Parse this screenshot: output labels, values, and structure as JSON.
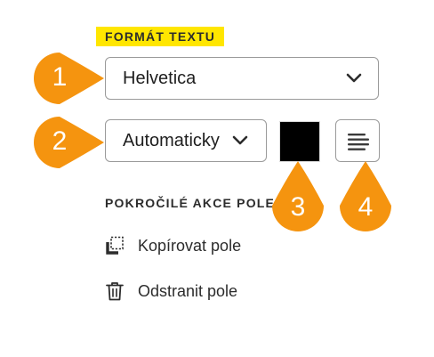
{
  "text_format": {
    "title": "FORMÁT TEXTU",
    "font_select": {
      "value": "Helvetica",
      "icon": "chevron-down-icon"
    },
    "size_select": {
      "value": "Automaticky",
      "icon": "chevron-down-icon"
    },
    "color_swatch": {
      "color": "#000000"
    },
    "align_button": {
      "icon": "align-left-icon"
    }
  },
  "advanced": {
    "title": "POKROČILÉ AKCE POLE",
    "actions": [
      {
        "label": "Kopírovat pole",
        "icon": "copy-field-icon"
      },
      {
        "label": "Odstranit pole",
        "icon": "trash-icon"
      }
    ]
  },
  "callouts": [
    {
      "number": "1"
    },
    {
      "number": "2"
    },
    {
      "number": "3"
    },
    {
      "number": "4"
    }
  ],
  "colors": {
    "highlight": "#ffe600",
    "callout": "#f5940f",
    "border": "#9a9a9a",
    "text": "#2c2c2c"
  }
}
